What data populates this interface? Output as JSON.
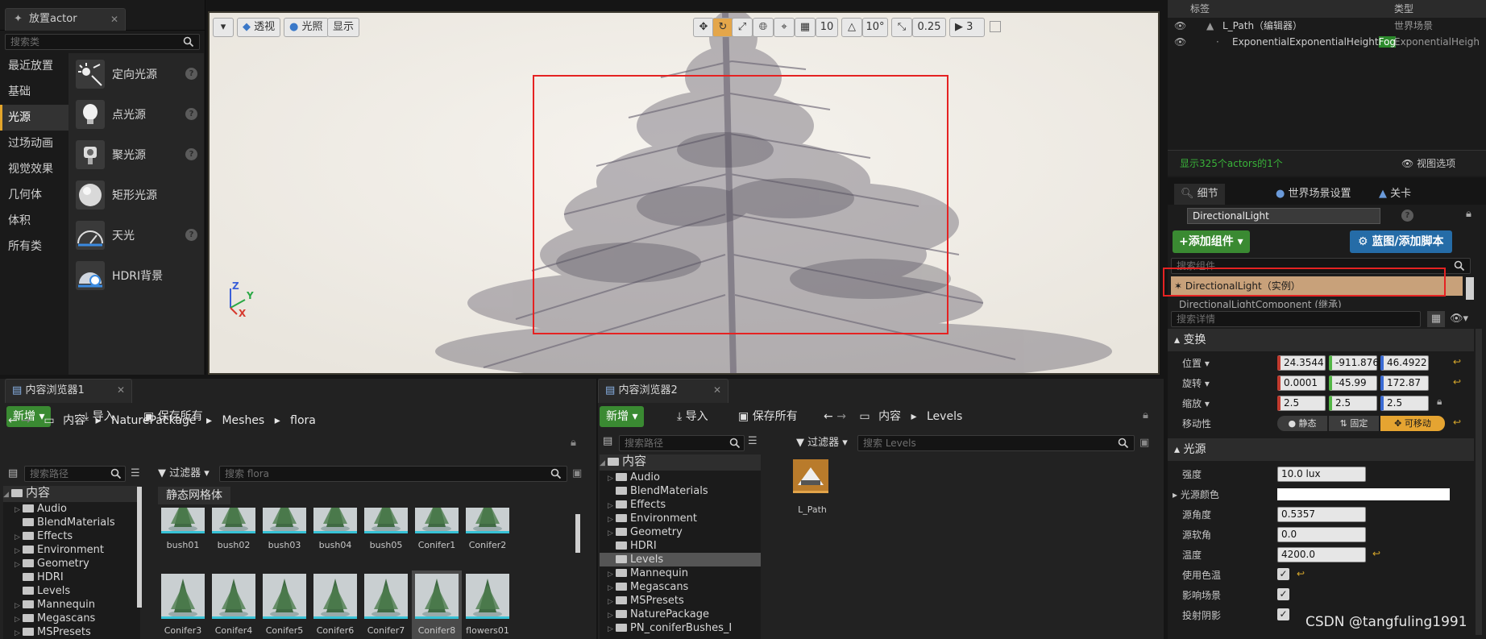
{
  "place_actors": {
    "tab_title": "放置actor",
    "search_placeholder": "搜索类",
    "categories": [
      "最近放置",
      "基础",
      "光源",
      "过场动画",
      "视觉效果",
      "几何体",
      "体积",
      "所有类"
    ],
    "active_category": "光源",
    "lights": [
      {
        "label": "定向光源",
        "icon": "directional-light-icon",
        "help": true
      },
      {
        "label": "点光源",
        "icon": "point-light-icon",
        "help": true
      },
      {
        "label": "聚光源",
        "icon": "spot-light-icon",
        "help": true
      },
      {
        "label": "矩形光源",
        "icon": "rect-light-icon",
        "help": true
      },
      {
        "label": "天光",
        "icon": "sky-light-icon",
        "help": true
      },
      {
        "label": "HDRI背景",
        "icon": "hdri-backdrop-icon",
        "help": false
      }
    ]
  },
  "viewport": {
    "perspective_label": "透视",
    "lit_label": "光照",
    "show_label": "显示",
    "grid_snap": "10",
    "rotation_snap": "10°",
    "scale_snap": "0.25",
    "camera_speed": "3",
    "axes": {
      "z": "Z",
      "y": "Y",
      "x": "X"
    },
    "colors": {
      "selection_rect": "#e52222",
      "active_tool": "#e4a64a"
    }
  },
  "outliner": {
    "col_label": "标签",
    "col_type": "类型",
    "rows": [
      {
        "label": "L_Path（编辑器）",
        "type": "世界场景"
      },
      {
        "label_main": "ExponentialExponentialHeight",
        "label_highlight": "Fog",
        "type": "ExponentialHeigh"
      }
    ],
    "status": "显示325个actors的1个",
    "view_options": "视图选项"
  },
  "details": {
    "tabs": [
      "细节",
      "世界场景设置",
      "关卡"
    ],
    "actor_name": "DirectionalLight",
    "add_component": "+添加组件",
    "blueprint": "蓝图/添加脚本",
    "search_component_placeholder": "搜索组件",
    "instance_label": "DirectionalLight（实例）",
    "component_partial": "DirectionalLightComponent (继承)",
    "search_details_placeholder": "搜索详情",
    "transform": {
      "title": "变换",
      "location": {
        "label": "位置",
        "x": "24.3544",
        "y": "-911.876",
        "z": "46.4922"
      },
      "rotation": {
        "label": "旋转",
        "x": "0.0001",
        "y": "-45.99",
        "z": "172.87"
      },
      "scale": {
        "label": "缩放",
        "x": "2.5",
        "y": "2.5",
        "z": "2.5"
      },
      "mobility": {
        "label": "移动性",
        "static": "静态",
        "stationary": "固定",
        "movable": "可移动"
      }
    },
    "light": {
      "title": "光源",
      "intensity": {
        "label": "强度",
        "value": "10.0 lux"
      },
      "light_color": {
        "label": "光源颜色"
      },
      "source_angle": {
        "label": "源角度",
        "value": "0.5357"
      },
      "source_soft_angle": {
        "label": "源软角",
        "value": "0.0"
      },
      "temperature": {
        "label": "温度",
        "value": "4200.0"
      },
      "use_temperature": {
        "label": "使用色温",
        "checked": true
      },
      "affects_world": {
        "label": "影响场景",
        "checked": true
      },
      "cast_shadows": {
        "label": "投射阴影",
        "checked": true
      }
    }
  },
  "content_browser_1": {
    "tab_title": "内容浏览器1",
    "new_label": "新增",
    "import_label": "导入",
    "save_all_label": "保存所有",
    "breadcrumb": [
      "内容",
      "NaturePackage",
      "Meshes",
      "flora"
    ],
    "search_path_placeholder": "搜索路径",
    "filter_label": "过滤器",
    "search_placeholder": "搜索 flora",
    "filter_chip": "静态网格体",
    "tree_root": "内容",
    "tree": [
      "Audio",
      "BlendMaterials",
      "Effects",
      "Environment",
      "Geometry",
      "HDRI",
      "Levels",
      "Mannequin",
      "Megascans",
      "MSPresets"
    ],
    "assets_row1": [
      "bush01",
      "bush02",
      "bush03",
      "bush04",
      "bush05",
      "Conifer1",
      "Conifer2"
    ],
    "assets_row2": [
      "Conifer3",
      "Conifer4",
      "Conifer5",
      "Conifer6",
      "Conifer7",
      "Conifer8",
      "flowers01"
    ],
    "selected_asset": "Conifer8"
  },
  "content_browser_2": {
    "tab_title": "内容浏览器2",
    "new_label": "新增",
    "import_label": "导入",
    "save_all_label": "保存所有",
    "breadcrumb": [
      "内容",
      "Levels"
    ],
    "search_path_placeholder": "搜索路径",
    "filter_label": "过滤器",
    "search_placeholder": "搜索 Levels",
    "tree_root": "内容",
    "tree": [
      "Audio",
      "BlendMaterials",
      "Effects",
      "Environment",
      "Geometry",
      "HDRI",
      "Levels",
      "Mannequin",
      "Megascans",
      "MSPresets",
      "NaturePackage",
      "PN_coniferBushes_I"
    ],
    "selected_folder": "Levels",
    "assets": [
      "L_Path"
    ]
  },
  "watermark": "CSDN @tangfuling1991"
}
